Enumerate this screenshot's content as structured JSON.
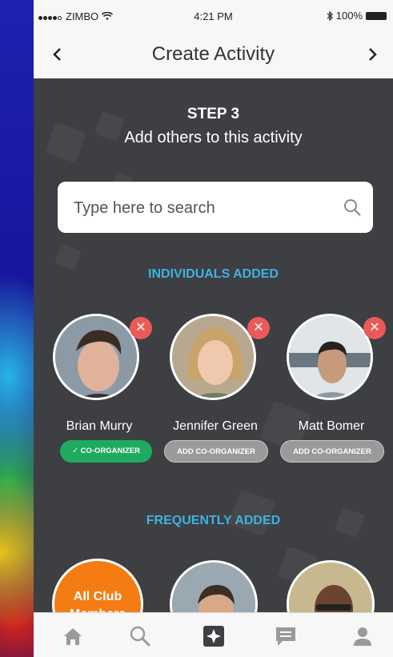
{
  "status_bar": {
    "carrier": "ZIMBO",
    "time": "4:21 PM",
    "battery": "100%"
  },
  "nav": {
    "title": "Create Activity"
  },
  "header": {
    "step": "STEP 3",
    "subtitle": "Add others to this activity"
  },
  "search": {
    "placeholder": "Type here to search"
  },
  "individuals": {
    "heading": "INDIVIDUALS ADDED",
    "people": [
      {
        "name": "Brian Murry",
        "role_button": "CO-ORGANIZER",
        "is_co_organizer": true
      },
      {
        "name": "Jennifer Green",
        "role_button": "ADD CO-ORGANIZER",
        "is_co_organizer": false
      },
      {
        "name": "Matt Bomer",
        "role_button": "ADD CO-ORGANIZER",
        "is_co_organizer": false
      }
    ]
  },
  "frequent": {
    "heading": "FREQUENTLY ADDED",
    "items": [
      {
        "label": "All Club Members",
        "color": "#f57c12"
      }
    ]
  },
  "colors": {
    "accent_blue": "#3fb1e3",
    "green": "#1eab5f",
    "remove_red": "#ea5a59",
    "content_bg": "#3d3f42"
  },
  "tabbar": {
    "icons": [
      "home-icon",
      "search-icon",
      "star-icon",
      "chat-icon",
      "profile-icon"
    ]
  }
}
